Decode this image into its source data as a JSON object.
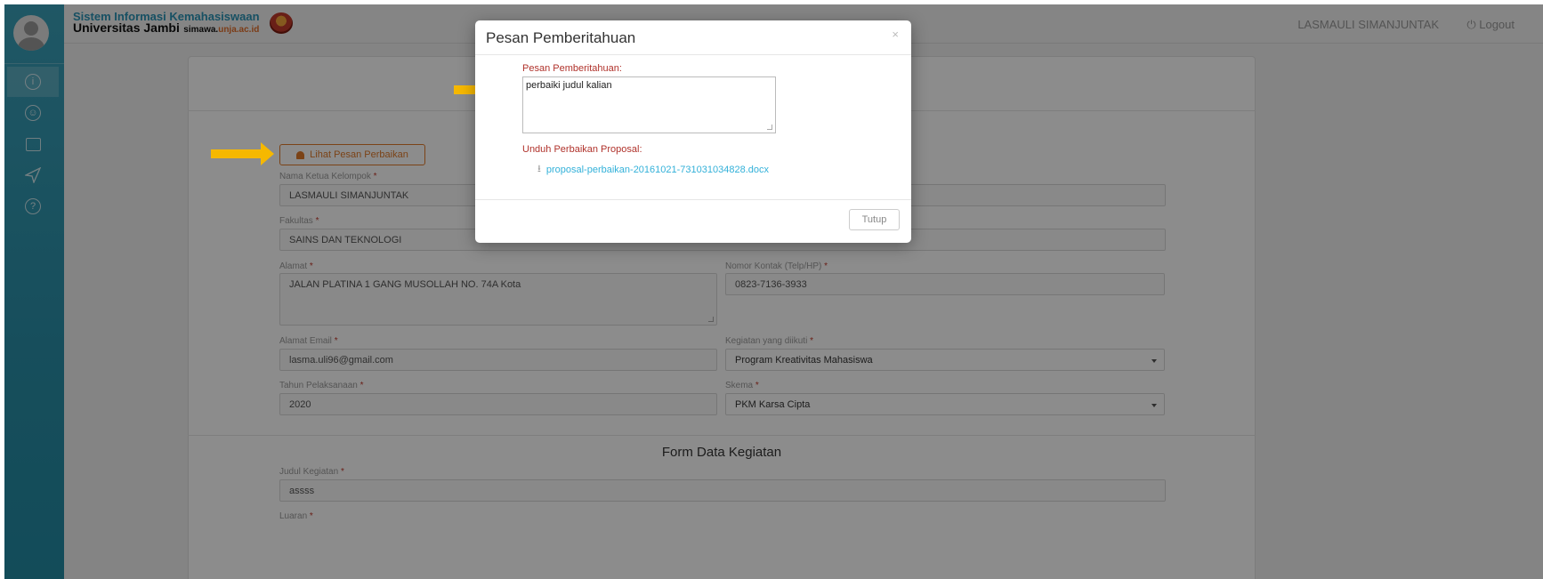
{
  "header": {
    "brand_line1": "Sistem Informasi Kemahasiswaan",
    "brand_line2": "Universitas Jambi",
    "brand_sub1": "simawa.",
    "brand_sub2": "unja.ac.id",
    "user_name": "LASMAULI SIMANJUNTAK",
    "logout_label": "Logout"
  },
  "sidebar": {
    "items": [
      {
        "icon": "info-icon",
        "active": true
      },
      {
        "icon": "user-group-icon",
        "active": false
      },
      {
        "icon": "document-icon",
        "active": false
      },
      {
        "icon": "send-icon",
        "active": false
      },
      {
        "icon": "help-icon",
        "active": false
      }
    ]
  },
  "form": {
    "lihat_pesan_label": "Lihat Pesan Perbaikan",
    "nama_ketua_label": "Nama Ketua Kelompok",
    "nama_ketua_value": "LASMAULI SIMANJUNTAK",
    "fakultas_label": "Fakultas",
    "fakultas_value": "SAINS DAN TEKNOLOGI",
    "alamat_label": "Alamat",
    "alamat_value": "JALAN PLATINA 1 GANG MUSOLLAH NO. 74A  Kota",
    "nomor_kontak_label": "Nomor Kontak (Telp/HP)",
    "nomor_kontak_value": "0823-7136-3933",
    "email_label": "Alamat Email",
    "email_value": "lasma.uli96@gmail.com",
    "kegiatan_label": "Kegiatan yang diikuti",
    "kegiatan_value": "Program Kreativitas Mahasiswa",
    "tahun_label": "Tahun Pelaksanaan",
    "tahun_value": "2020",
    "skema_label": "Skema",
    "skema_value": "PKM Karsa Cipta",
    "section_title": "Form Data Kegiatan",
    "judul_label": "Judul Kegiatan",
    "judul_value": "assss",
    "luaran_label": "Luaran",
    "required_mark": "*"
  },
  "modal": {
    "title": "Pesan Pemberitahuan",
    "close_glyph": "×",
    "pesan_label": "Pesan Pemberitahuan:",
    "pesan_value": "perbaiki judul kalian",
    "unduh_label": "Unduh Perbaikan Proposal:",
    "file_link": "proposal-perbaikan-20161021-731031034828.docx",
    "close_button": "Tutup"
  },
  "colors": {
    "sidebar": "#2a8fa8",
    "accent_orange": "#e07a2a",
    "arrow": "#f6b800",
    "link": "#33b1d9",
    "label_red": "#b0322b"
  }
}
